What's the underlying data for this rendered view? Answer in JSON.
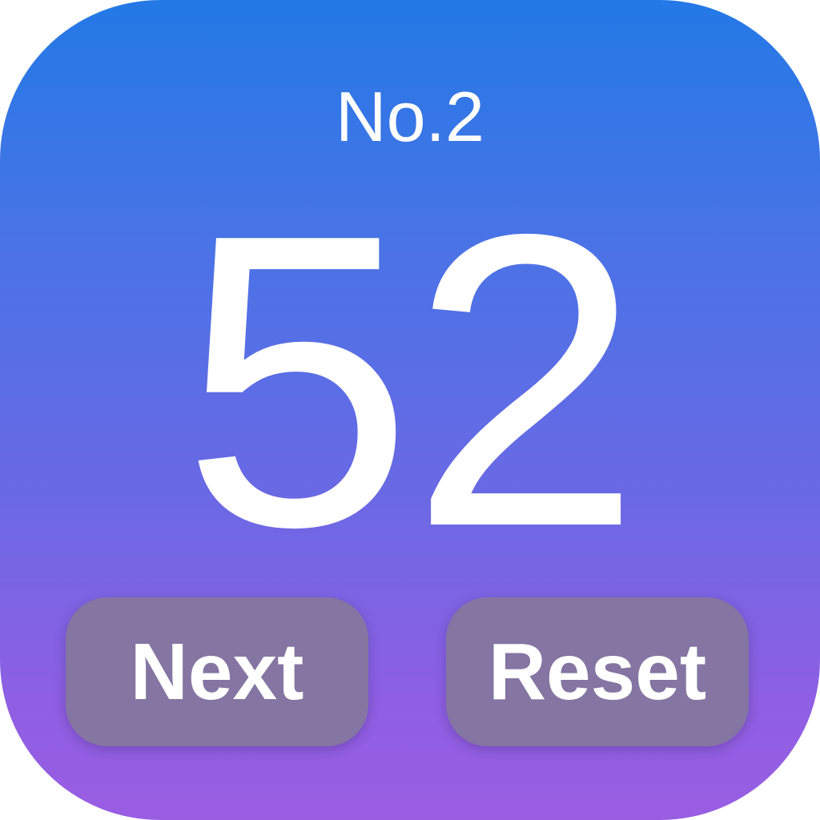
{
  "counter": {
    "label": "No.2",
    "value": "52"
  },
  "buttons": {
    "next_label": "Next",
    "reset_label": "Reset"
  },
  "colors": {
    "gradient_top": "#2379e6",
    "gradient_bottom": "#995de2",
    "button_fill": "#85769e",
    "text": "#ffffff"
  }
}
